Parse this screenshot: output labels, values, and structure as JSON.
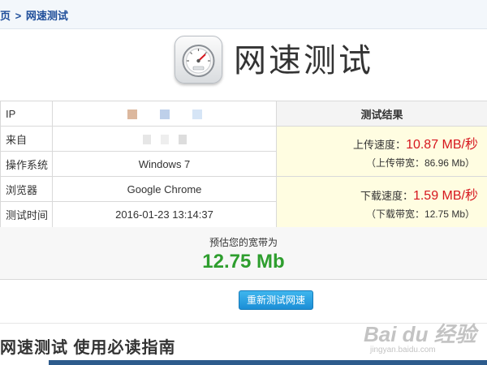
{
  "breadcrumb": {
    "home_partial": "页",
    "separator": ">",
    "current": "网速测试"
  },
  "header": {
    "icon": "speedometer-icon",
    "title": "网速测试"
  },
  "table": {
    "rows": [
      {
        "label": "IP",
        "value": ""
      },
      {
        "label": "来自",
        "value": ""
      },
      {
        "label": "操作系统",
        "value": "Windows 7"
      },
      {
        "label": "浏览器",
        "value": "Google Chrome"
      },
      {
        "label": "测试时间",
        "value": "2016-01-23 13:14:37"
      }
    ],
    "result_header": "测试结果",
    "upload": {
      "label": "上传速度：",
      "value": "10.87 MB/秒",
      "bandwidth": "（上传带宽：86.96 Mb）"
    },
    "download": {
      "label": "下载速度：",
      "value": "1.59 MB/秒",
      "bandwidth": "（下载带宽：12.75 Mb）"
    }
  },
  "estimate": {
    "label": "预估您的宽带为",
    "value": "12.75 Mb"
  },
  "retest_button": "重新测试网速",
  "guide_title": "网速测试 使用必读指南",
  "watermark": {
    "text": "Bai du 经验",
    "url": "jingyan.baidu.com"
  },
  "colors": {
    "speed_red": "#d6161e",
    "estimate_green": "#2e9e2e",
    "button_blue": "#1b8ed6",
    "result_bg": "#fffde1"
  }
}
